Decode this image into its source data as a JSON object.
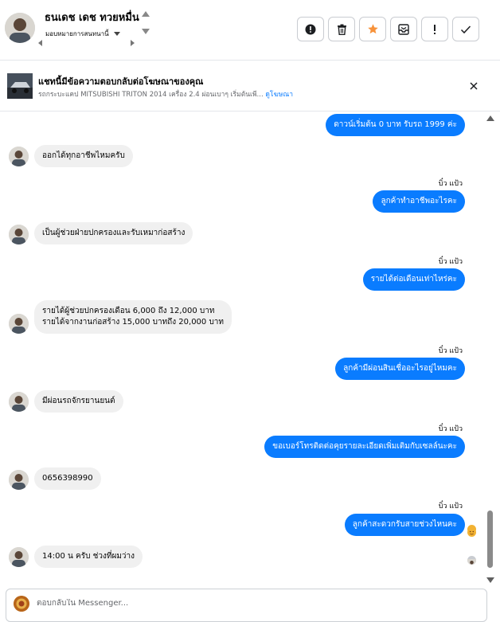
{
  "header": {
    "contact_name": "ธนเดช เดช ทวยหมื่น",
    "assigned_label": "มอบหมายการสนทนานี้",
    "actions": [
      "mark-spam",
      "delete",
      "star",
      "archive",
      "follow-up",
      "mark-done"
    ]
  },
  "ad": {
    "title": "แชทนี้มีข้อความตอบกลับต่อโฆษณาของคุณ",
    "subtitle": "รถกระบะแคป MITSUBISHI TRITON 2014 เครื่อง 2.4 ผ่อนเบาๆ เริ่มต้นเพี...",
    "link": "ดูโฆษณา"
  },
  "messages": [
    {
      "side": "out",
      "text": "ดาวน์เริ่มต้น 0 บาท รับรถ 1999 ค่ะ"
    },
    {
      "side": "in",
      "text": "ออกได้ทุกอาชีพไหมครับ"
    },
    {
      "side": "out",
      "sender": "บิ๋ว แป้ว",
      "text": "ลูกค้าทำอาชีพอะไรคะ"
    },
    {
      "side": "in",
      "text": "เป็นผู้ช่วยฝ่ายปกครองและรับเหมาก่อสร้าง"
    },
    {
      "side": "out",
      "sender": "บิ๋ว แป้ว",
      "text": "รายได้ต่อเดือนเท่าไหร่คะ"
    },
    {
      "side": "in",
      "text_line1": "รายได้ผู้ช่วยปกครองเดือน 6,000 ถึง 12,000 บาท",
      "text_line2": "รายได้จากงานก่อสร้าง 15,000 บาทถึง 20,000 บาท"
    },
    {
      "side": "out",
      "sender": "บิ๋ว แป้ว",
      "text": "ลูกค้ามีผ่อนสินเชื่ออะไรอยู่ไหมคะ"
    },
    {
      "side": "in",
      "text": "มีผ่อนรถจักรยานยนต์"
    },
    {
      "side": "out",
      "sender": "บิ๋ว แป้ว",
      "text": "ขอเบอร์โทรติดต่อคุยรายละเอียดเพิ่มเติมกับเซลล์นะคะ"
    },
    {
      "side": "in",
      "text": "0656398990"
    },
    {
      "side": "out",
      "sender": "บิ๋ว แป้ว",
      "text": "ลูกค้าสะดวกรับสายช่วงไหนคะ"
    },
    {
      "side": "in",
      "text": "14:00 น ครับ ช่วงที่ผมว่าง"
    }
  ],
  "composer": {
    "placeholder": "ตอบกลับใน Messenger..."
  },
  "colors": {
    "outgoing_bubble": "#0a7cff",
    "incoming_bubble": "#f0f0f0",
    "star": "#f7923a"
  }
}
